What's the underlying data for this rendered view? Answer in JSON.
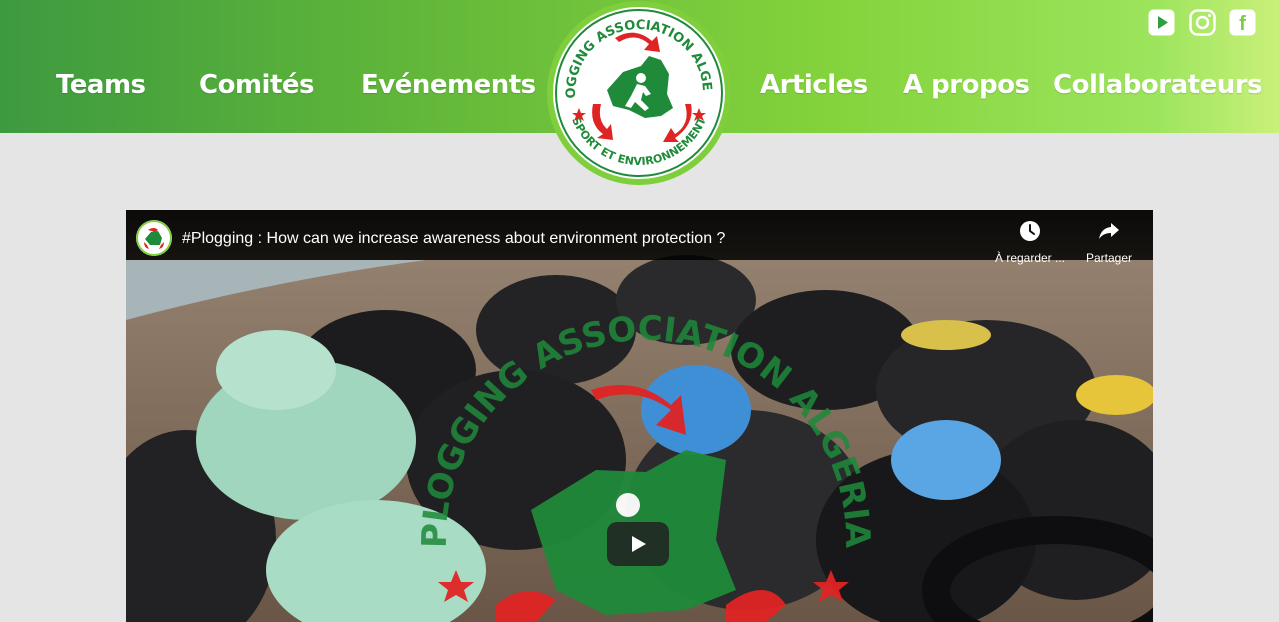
{
  "nav": {
    "left": [
      "Teams",
      "Comités",
      "Evénements"
    ],
    "right": [
      "Articles",
      "A propos",
      "Collaborateurs"
    ]
  },
  "social": {
    "icons": [
      "youtube-icon",
      "instagram-icon",
      "facebook-icon"
    ],
    "facebook_glyph": "f"
  },
  "logo": {
    "top_text": "PLOGGING ASSOCIATION ALGERIA",
    "bottom_text": "SPORT ET ENVIRONNEMENT"
  },
  "video": {
    "title": "#Plogging : How can we increase awareness about environment protection ?",
    "watch_later_label": "À regarder ...",
    "share_label": "Partager",
    "watermark_text": "PLOGGING ASSOCIATION ALGERIA"
  },
  "colors": {
    "header_start": "#3d9a3f",
    "header_end": "#c9f07a",
    "logo_green": "#1e8a3a",
    "logo_red": "#e02424",
    "page_bg": "#e5e5e5"
  }
}
